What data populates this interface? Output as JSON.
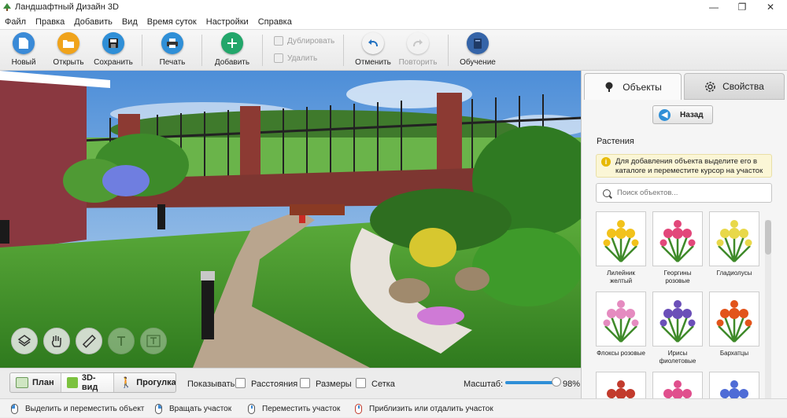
{
  "window": {
    "title": "Ландшафтный Дизайн 3D",
    "minimize": "—",
    "maximize": "❐",
    "close": "✕"
  },
  "menu": [
    "Файл",
    "Правка",
    "Добавить",
    "Вид",
    "Время суток",
    "Настройки",
    "Справка"
  ],
  "toolbar": {
    "new": "Новый",
    "open": "Открыть",
    "save": "Сохранить",
    "print": "Печать",
    "add": "Добавить",
    "duplicate": "Дублировать",
    "delete": "Удалить",
    "undo": "Отменить",
    "redo": "Повторить",
    "learn": "Обучение"
  },
  "view_modes": {
    "plan": "План",
    "view3d": "3D-вид",
    "walk": "Прогулка",
    "active": "3D-вид"
  },
  "display": {
    "label": "Показывать:",
    "distances": "Расстояния",
    "sizes": "Размеры",
    "grid": "Сетка"
  },
  "zoom": {
    "label": "Масштаб:",
    "value": "98%",
    "fraction": 0.98
  },
  "status": [
    "Выделить и переместить объект",
    "Вращать участок",
    "Переместить участок",
    "Приблизить или отдалить участок"
  ],
  "panel": {
    "tab_objects": "Объекты",
    "tab_properties": "Свойства",
    "back": "Назад",
    "category": "Растения",
    "hint": "Для добавления объекта выделите его в каталоге и переместите курсор на участок",
    "search_placeholder": "Поиск объектов...",
    "items": [
      {
        "label": "Лилейник желтый",
        "color": "#f2c21b"
      },
      {
        "label": "Георгины розовые",
        "color": "#e2477a"
      },
      {
        "label": "Гладиолусы",
        "color": "#e8d84a"
      },
      {
        "label": "Флоксы розовые",
        "color": "#e58bc0"
      },
      {
        "label": "Ирисы фиолетовые",
        "color": "#6b4fb8"
      },
      {
        "label": "Бархатцы",
        "color": "#e2541b"
      },
      {
        "label": "",
        "color": "#c23b2d"
      },
      {
        "label": "",
        "color": "#e04f8d"
      },
      {
        "label": "",
        "color": "#4f6cd6"
      }
    ]
  },
  "colors": {
    "accent": "#2f8fd7",
    "new": "#3a8ad7",
    "open": "#f0a31b",
    "save": "#2f8fd7",
    "add": "#22a66a",
    "learn": "#3564a8"
  }
}
